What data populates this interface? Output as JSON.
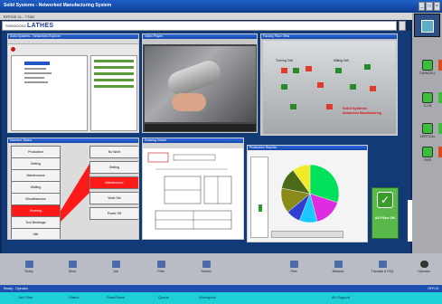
{
  "window": {
    "title": "Solid Systems - Networked Manufacturing System",
    "menu": "EFFICE CL - TTAG",
    "address_prefix": "SHEMOON2",
    "address_title": "LATHES"
  },
  "windows": {
    "explorer": {
      "title": "Solid Systems - Networked Explorer"
    },
    "video": {
      "title": "Video Player"
    },
    "floor": {
      "title": "Factory Floor View",
      "labels": [
        "Turning Cell",
        "Milling Cell",
        "Swiss Turning"
      ],
      "overlay_line1": "Solid Systems",
      "overlay_line2": "Networked Manufacturing"
    },
    "status": {
      "title": "Machine Status",
      "left_items": [
        "Production",
        "Setting",
        "Maintenance",
        "Waiting",
        "Miscellaneous",
        "Running",
        "Tool Breakage",
        "Idle"
      ],
      "right_items": [
        "No Work",
        "Setting",
        "Maintenance",
        "Work Set",
        "Power Off"
      ]
    },
    "drawing": {
      "title": "Drawing Viewer"
    },
    "chart": {
      "title": "Production Reports"
    },
    "allfiles": {
      "label": "All Files OK"
    }
  },
  "chart_data": {
    "type": "pie",
    "title": "",
    "slices": [
      {
        "label": "green",
        "value": 30,
        "color": "#00e05a"
      },
      {
        "label": "magenta",
        "value": 16,
        "color": "#e02ce0"
      },
      {
        "label": "cyan",
        "value": 10,
        "color": "#19c8ff"
      },
      {
        "label": "blue",
        "value": 8,
        "color": "#2f3fd0"
      },
      {
        "label": "olive",
        "value": 14,
        "color": "#8a8a18"
      },
      {
        "label": "darkgreen",
        "value": 12,
        "color": "#4a6a18"
      },
      {
        "label": "yellow",
        "value": 10,
        "color": "#f0ea28"
      }
    ]
  },
  "right_toolbar": [
    {
      "label": "TURNCELL",
      "color": "#e04a1a"
    },
    {
      "label": "C-CB",
      "color": "#3bbf3a"
    },
    {
      "label": "VERTICAL",
      "color": "#3bbf3a"
    },
    {
      "label": "C60S",
      "color": "#e04a1a"
    }
  ],
  "taskbar": {
    "buttons": [
      "Setup",
      "Send",
      "Job",
      "Print",
      "Search",
      "Files",
      "Network",
      "Tutorials & FAQ",
      "Operator"
    ]
  },
  "statusbar": {
    "left": "Ready - Operator",
    "right": "OFF/13"
  },
  "tabs": [
    "Job Files",
    "Status",
    "Start/Finish",
    "Queue",
    "Workspool",
    "AV Support"
  ]
}
